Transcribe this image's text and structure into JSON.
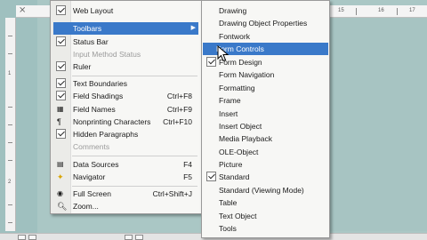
{
  "ruler": {
    "left_numbers": [
      "1",
      "2"
    ],
    "top_numbers": [
      "15",
      "16",
      "17"
    ]
  },
  "view_menu": {
    "items": [
      {
        "label": "Web Layout",
        "underline_char": "W",
        "checked": false
      },
      {
        "label": "Toolbars",
        "highlighted": true,
        "submenu": true
      },
      {
        "label": "Status Bar",
        "checked": true
      },
      {
        "label": "Input Method Status",
        "disabled": true
      },
      {
        "label": "Ruler",
        "checked": true
      },
      {
        "label": "Text Boundaries",
        "checked": true
      },
      {
        "label": "Field Shadings",
        "shortcut": "Ctrl+F8",
        "checked": true
      },
      {
        "label": "Field Names",
        "shortcut": "Ctrl+F9"
      },
      {
        "label": "Nonprinting Characters",
        "shortcut": "Ctrl+F10"
      },
      {
        "label": "Hidden Paragraphs",
        "checked": true
      },
      {
        "label": "Comments",
        "disabled": true
      },
      {
        "label": "Data Sources",
        "shortcut": "F4"
      },
      {
        "label": "Navigator",
        "shortcut": "F5"
      },
      {
        "label": "Full Screen",
        "shortcut": "Ctrl+Shift+J"
      },
      {
        "label": "Zoom..."
      }
    ]
  },
  "toolbars_menu": {
    "items": [
      {
        "label": "Drawing"
      },
      {
        "label": "Drawing Object Properties"
      },
      {
        "label": "Fontwork"
      },
      {
        "label": "Form Controls",
        "highlighted": true
      },
      {
        "label": "Form Design",
        "checked": true
      },
      {
        "label": "Form Navigation"
      },
      {
        "label": "Formatting"
      },
      {
        "label": "Frame"
      },
      {
        "label": "Insert"
      },
      {
        "label": "Insert Object"
      },
      {
        "label": "Media Playback"
      },
      {
        "label": "OLE-Object"
      },
      {
        "label": "Picture"
      },
      {
        "label": "Standard",
        "checked": true
      },
      {
        "label": "Standard (Viewing Mode)"
      },
      {
        "label": "Table"
      },
      {
        "label": "Text Object"
      },
      {
        "label": "Tools"
      }
    ]
  },
  "colors": {
    "highlight": "#3a79c9",
    "menu_bg": "#f7f7f5",
    "background": "#aac7c5"
  }
}
